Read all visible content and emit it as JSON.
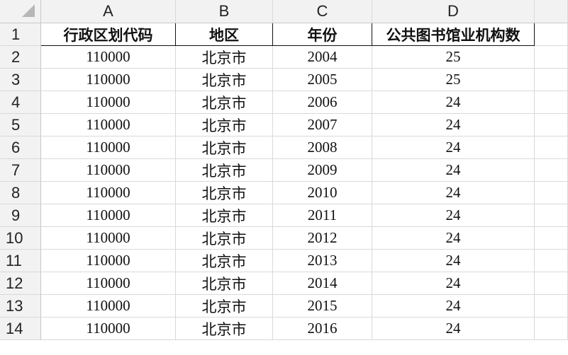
{
  "columns": [
    "A",
    "B",
    "C",
    "D"
  ],
  "header_row": {
    "row_number": "1",
    "cells": [
      "行政区划代码",
      "地区",
      "年份",
      "公共图书馆业机构数"
    ]
  },
  "rows": [
    {
      "row_number": "2",
      "cells": [
        "110000",
        "北京市",
        "2004",
        "25"
      ]
    },
    {
      "row_number": "3",
      "cells": [
        "110000",
        "北京市",
        "2005",
        "25"
      ]
    },
    {
      "row_number": "4",
      "cells": [
        "110000",
        "北京市",
        "2006",
        "24"
      ]
    },
    {
      "row_number": "5",
      "cells": [
        "110000",
        "北京市",
        "2007",
        "24"
      ]
    },
    {
      "row_number": "6",
      "cells": [
        "110000",
        "北京市",
        "2008",
        "24"
      ]
    },
    {
      "row_number": "7",
      "cells": [
        "110000",
        "北京市",
        "2009",
        "24"
      ]
    },
    {
      "row_number": "8",
      "cells": [
        "110000",
        "北京市",
        "2010",
        "24"
      ]
    },
    {
      "row_number": "9",
      "cells": [
        "110000",
        "北京市",
        "2011",
        "24"
      ]
    },
    {
      "row_number": "10",
      "cells": [
        "110000",
        "北京市",
        "2012",
        "24"
      ]
    },
    {
      "row_number": "11",
      "cells": [
        "110000",
        "北京市",
        "2013",
        "24"
      ]
    },
    {
      "row_number": "12",
      "cells": [
        "110000",
        "北京市",
        "2014",
        "24"
      ]
    },
    {
      "row_number": "13",
      "cells": [
        "110000",
        "北京市",
        "2015",
        "24"
      ]
    },
    {
      "row_number": "14",
      "cells": [
        "110000",
        "北京市",
        "2016",
        "24"
      ]
    }
  ]
}
